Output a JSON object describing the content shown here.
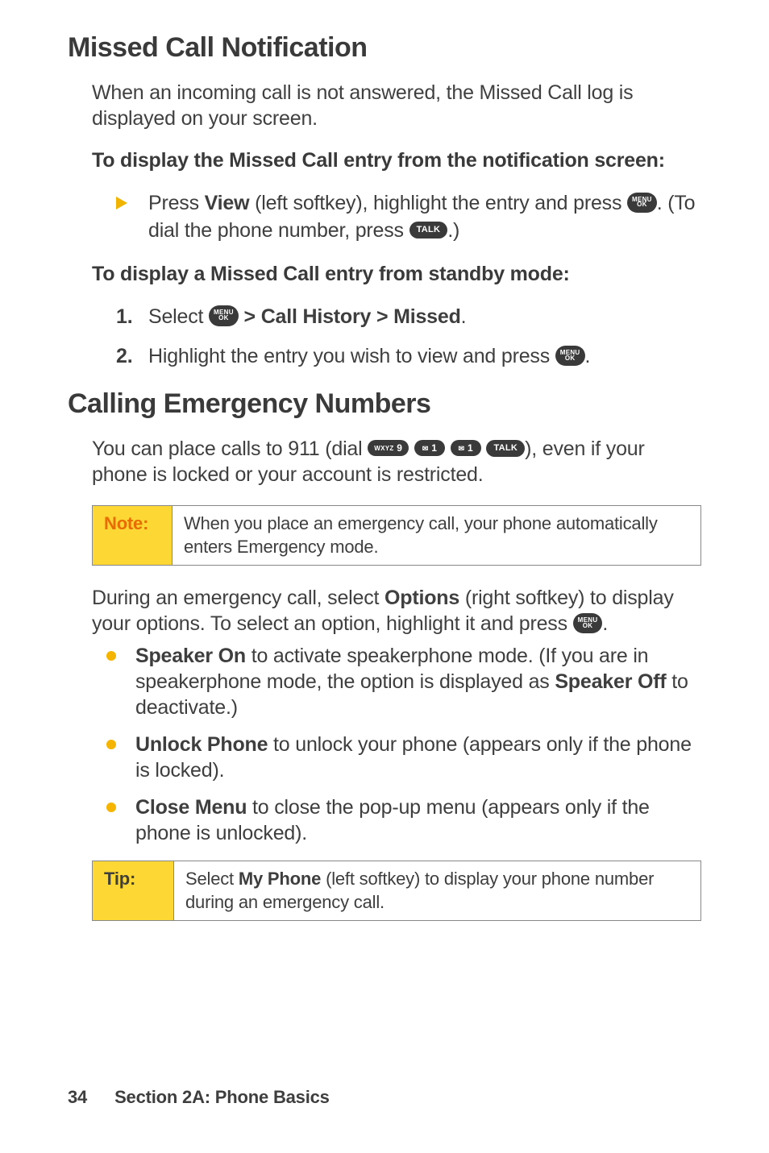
{
  "h1": "Missed Call Notification",
  "p_intro": "When an incoming call is not answered, the Missed Call log is displayed on your screen.",
  "sub1": "To display the Missed Call entry from the notification screen:",
  "step_view_a": "Press ",
  "step_view_b": "View",
  "step_view_c": " (left softkey), highlight the entry and press ",
  "step_view_d": ". (To dial the phone number, press ",
  "step_view_e": ".)",
  "sub2": "To display a Missed Call entry from standby mode:",
  "standby": {
    "s1_num": "1.",
    "s1_a": "Select ",
    "s1_b": " > Call History > Missed",
    "s1_c": ".",
    "s2_num": "2.",
    "s2_a": "Highlight the entry you wish to view and press ",
    "s2_b": "."
  },
  "h2": "Calling Emergency Numbers",
  "emerg_a": "You can place calls to 911 (dial ",
  "emerg_b": "), even if your phone is locked or your account is restricted.",
  "note_label": "Note:",
  "note_body": "When you place an emergency call, your phone automatically enters Emergency mode.",
  "options_a": "During an emergency call, select ",
  "options_b": "Options",
  "options_c": " (right softkey) to display your options. To select an option, highlight it and press ",
  "options_d": ".",
  "bullets": {
    "b1_a": "Speaker On",
    "b1_b": " to activate speakerphone mode. (If you are in speakerphone mode, the option is displayed as ",
    "b1_c": "Speaker Off",
    "b1_d": " to deactivate.)",
    "b2_a": "Unlock Phone",
    "b2_b": " to unlock your phone (appears only if the phone is locked).",
    "b3_a": "Close Menu",
    "b3_b": " to close the pop-up menu (appears only if the phone is unlocked)."
  },
  "tip_label": "Tip:",
  "tip_a": "Select ",
  "tip_b": "My Phone",
  "tip_c": " (left softkey) to display your phone number during an emergency call.",
  "footer_page": "34",
  "footer_section": "Section 2A: Phone Basics",
  "keys": {
    "menu_top": "MENU",
    "menu_bot": "OK",
    "talk": "TALK",
    "nine_sm": "WXYZ",
    "nine": "9",
    "one": "1"
  }
}
